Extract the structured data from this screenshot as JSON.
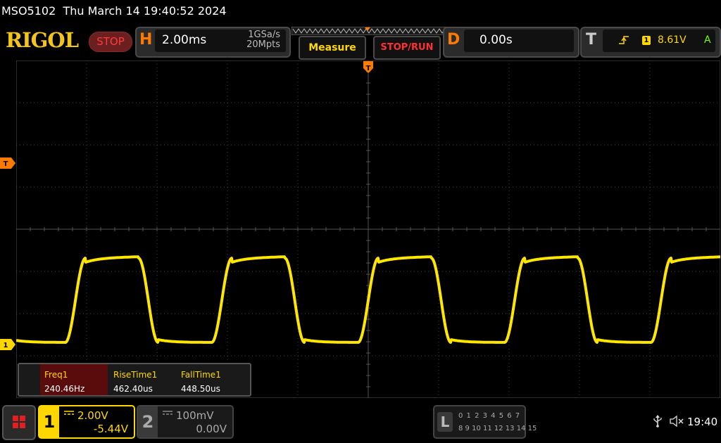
{
  "status": {
    "model": "MSO5102",
    "datetime": "Thu March 14 19:40:52 2024"
  },
  "header": {
    "logo": "RIGOL",
    "run_state": "STOP",
    "horizontal": {
      "letter": "H",
      "timebase": "2.00ms",
      "sample_rate": "1GSa/s",
      "memory_depth": "20Mpts"
    },
    "measure_button": "Measure",
    "stoprun_button": "STOP/RUN",
    "delay": {
      "letter": "D",
      "value": "0.00s"
    },
    "trigger": {
      "letter": "T",
      "edge_icon": "rising-edge-icon",
      "source": "1",
      "level": "8.61V",
      "mode": "A"
    }
  },
  "markers": {
    "trigger_position": "T",
    "trigger_level": "T",
    "channel1": "1"
  },
  "measurements": [
    {
      "label": "Freq1",
      "value": "240.46Hz"
    },
    {
      "label": "RiseTime1",
      "value": "462.40us"
    },
    {
      "label": "FallTime1",
      "value": "448.50us"
    }
  ],
  "channels": {
    "ch1": {
      "number": "1",
      "coupling": "DC",
      "scale": "2.00V",
      "offset": "-5.44V"
    },
    "ch2": {
      "number": "2",
      "coupling": "DC",
      "scale": "100mV",
      "offset": "0.00V"
    }
  },
  "logic_analyzer": {
    "letter": "L",
    "row1": "0 1 2 3   4 5 6 7",
    "row2": "8 9 10 11  12 13 14 15"
  },
  "system": {
    "clock": "19:40"
  },
  "colors": {
    "ch1": "#ffd700",
    "accent": "#ff7a00",
    "stop": "#ff3030"
  },
  "waveform": {
    "channel": "1",
    "shape": "square",
    "frequency_hz": 240.46,
    "rise_time_us": 462.4,
    "fall_time_us": 448.5
  }
}
